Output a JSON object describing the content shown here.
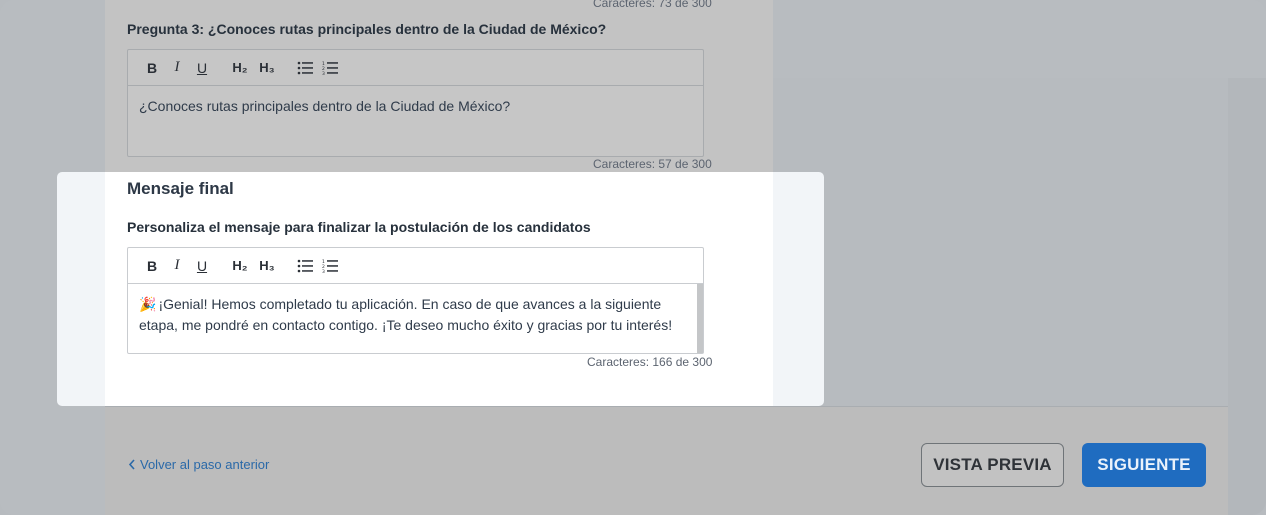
{
  "q2": {
    "counter": "Caracteres: 73 de 300"
  },
  "q3": {
    "label": "Pregunta 3: ¿Conoces rutas principales dentro de la Ciudad de México?",
    "text": "¿Conoces rutas principales dentro de la Ciudad de México?",
    "counter": "Caracteres: 57 de 300"
  },
  "toolbar": {
    "bold": "B",
    "italic": "I",
    "underline": "U",
    "h2": "H₂",
    "h3": "H₃",
    "bullet_icon": "bulleted-list-icon",
    "numbered_icon": "numbered-list-icon"
  },
  "final_message": {
    "title": "Mensaje final",
    "label": "Personaliza el mensaje para finalizar la postulación de los candidatos",
    "emoji": "🎉",
    "text": "¡Genial! Hemos completado tu aplicación. En caso de que avances a la siguiente etapa, me pondré en contacto contigo. ¡Te deseo mucho éxito y gracias por tu interés!",
    "counter": "Caracteres: 166 de 300"
  },
  "footer": {
    "back_label": "Volver al paso anterior",
    "preview_label": "VISTA PREVIA",
    "next_label": "SIGUIENTE"
  },
  "colors": {
    "primary": "#1f6cc0",
    "link": "#2a69a8",
    "overlay": "#b7bbbf"
  }
}
